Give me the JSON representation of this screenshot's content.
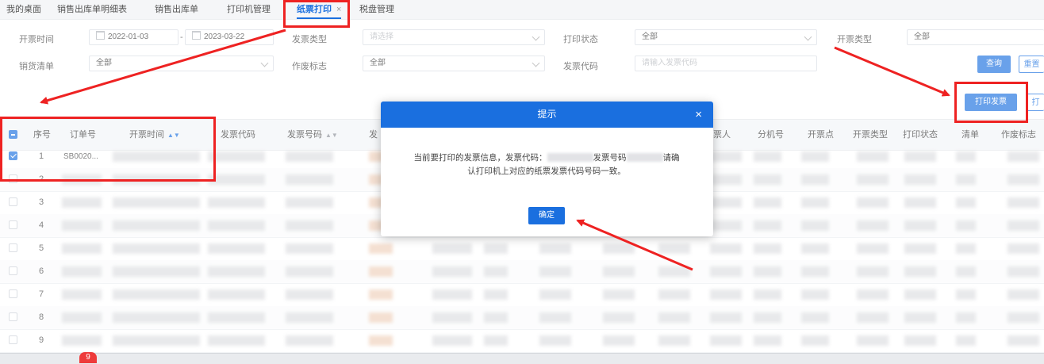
{
  "tabs": [
    {
      "label": "我的桌面"
    },
    {
      "label": "销售出库单明细表"
    },
    {
      "label": "销售出库单"
    },
    {
      "label": "打印机管理"
    },
    {
      "label": "纸票打印",
      "active": true,
      "close": "×"
    },
    {
      "label": "税盘管理"
    }
  ],
  "filters": {
    "invoice_time_label": "开票时间",
    "date_from": "2022-01-03",
    "date_sep": "-",
    "date_to": "2023-03-22",
    "invoice_type_label": "发票类型",
    "invoice_type_placeholder": "请选择",
    "print_status_label": "打印状态",
    "print_status_value": "全部",
    "billing_type_label": "开票类型",
    "billing_type_value": "全部",
    "sales_list_label": "销货清单",
    "sales_list_value": "全部",
    "void_flag_label": "作废标志",
    "void_flag_value": "全部",
    "invoice_code_label": "发票代码",
    "invoice_code_placeholder": "请输入发票代码"
  },
  "buttons": {
    "query": "查询",
    "reset": "重置",
    "print_invoice": "打印发票",
    "print_other": "打"
  },
  "table": {
    "columns": [
      "序号",
      "订单号",
      "开票时间",
      "发票代码",
      "发票号码",
      "发",
      "票人",
      "分机号",
      "开票点",
      "开票类型",
      "打印状态",
      "清单",
      "作废标志"
    ],
    "rows": [
      {
        "index": "1",
        "order": "SB0020...",
        "checked": true
      },
      {
        "index": "2"
      },
      {
        "index": "3"
      },
      {
        "index": "4"
      },
      {
        "index": "5"
      },
      {
        "index": "6"
      },
      {
        "index": "7"
      },
      {
        "index": "8"
      },
      {
        "index": "9"
      }
    ]
  },
  "dialog": {
    "title": "提示",
    "close": "×",
    "line1_a": "当前要打印的发票信息，发票代码：",
    "line1_b": "发票号码",
    "line1_c": "请确",
    "line2": "认打印机上对应的纸票发票代码号码一致。",
    "ok": "确定"
  },
  "taskbar": {
    "badge": "9"
  },
  "colors": {
    "accent": "#1a6fdf",
    "annotation": "#ee2222"
  }
}
